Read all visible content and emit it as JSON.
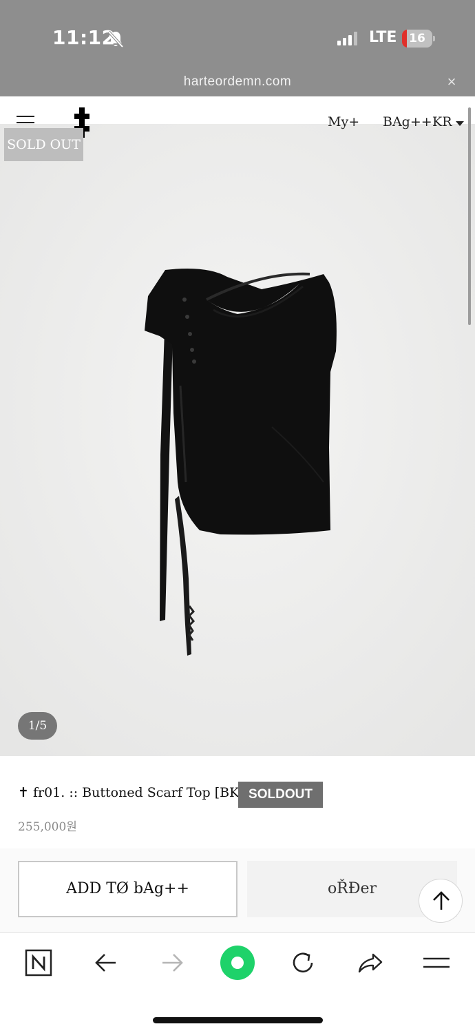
{
  "status_bar": {
    "time": "11:12",
    "network": "LTE",
    "battery_level": "16",
    "battery_fraction": 0.16,
    "icons": [
      "bell-slash-icon",
      "cellular-signal-icon",
      "battery-icon"
    ]
  },
  "browser": {
    "url": "harteordemn.com",
    "close_glyph": "×",
    "toolbar_icons": [
      "naver-n-icon",
      "back-arrow-icon",
      "forward-arrow-icon",
      "green-dot-icon",
      "reload-icon",
      "share-icon",
      "menu-icon"
    ]
  },
  "header": {
    "logo_icon": "double-cross-logo-icon",
    "nav": {
      "my": "My+",
      "bag": "BAg++",
      "lang": "KR"
    }
  },
  "gallery": {
    "sold_out_label": "SOLD OUT",
    "page_indicator": "1/5",
    "image_icon": "black-scarf-top-image"
  },
  "product": {
    "title": "✝ fr01. :: Buttoned Scarf Top [BK]",
    "badge": "SOLDOUT",
    "price": "255,000원"
  },
  "actions": {
    "add_to_bag": "ADD TØ bAg++",
    "order": "oŘĐer",
    "scroll_top_icon": "arrow-up-icon"
  },
  "colors": {
    "status_bg": "#8e8e8e",
    "image_bg": "#ececeb",
    "badge_bg": "#6f6f6f",
    "accent_green": "#1ed26a"
  }
}
